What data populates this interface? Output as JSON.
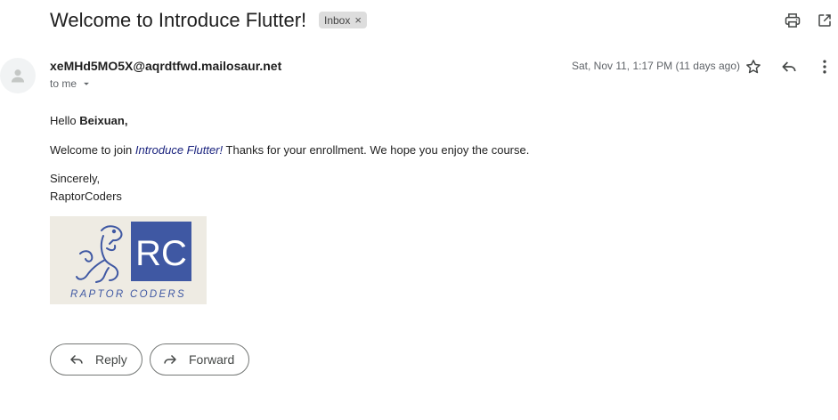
{
  "email": {
    "subject": "Welcome to Introduce Flutter!",
    "label_chip": "Inbox",
    "label_chip_remove": "×",
    "sender": "xeMHd5MO5X@aqrdtfwd.mailosaur.net",
    "recipient_line": "to me",
    "date": "Sat, Nov 11, 1:17 PM (11 days ago)"
  },
  "body": {
    "greeting_prefix": "Hello ",
    "greeting_name": "Beixuan,",
    "welcome_prefix": "Welcome to join ",
    "course_name": "Introduce Flutter!",
    "welcome_suffix": " Thanks for your enrollment. We hope you enjoy the course.",
    "signoff": "Sincerely,",
    "signature": "RaptorCoders"
  },
  "logo": {
    "initials": "RC",
    "wordmark": "RAPTOR CODERS",
    "color": "#3f58a3",
    "background": "#eeebe3"
  },
  "actions": {
    "reply_label": "Reply",
    "forward_label": "Forward"
  },
  "icons": {
    "print": "print-icon",
    "open_new_window": "open-in-new-window-icon",
    "star": "star-icon",
    "reply": "reply-icon",
    "more": "more-vert-icon",
    "avatar": "person-icon",
    "dropdown": "caret-down-icon",
    "forward": "forward-icon"
  }
}
